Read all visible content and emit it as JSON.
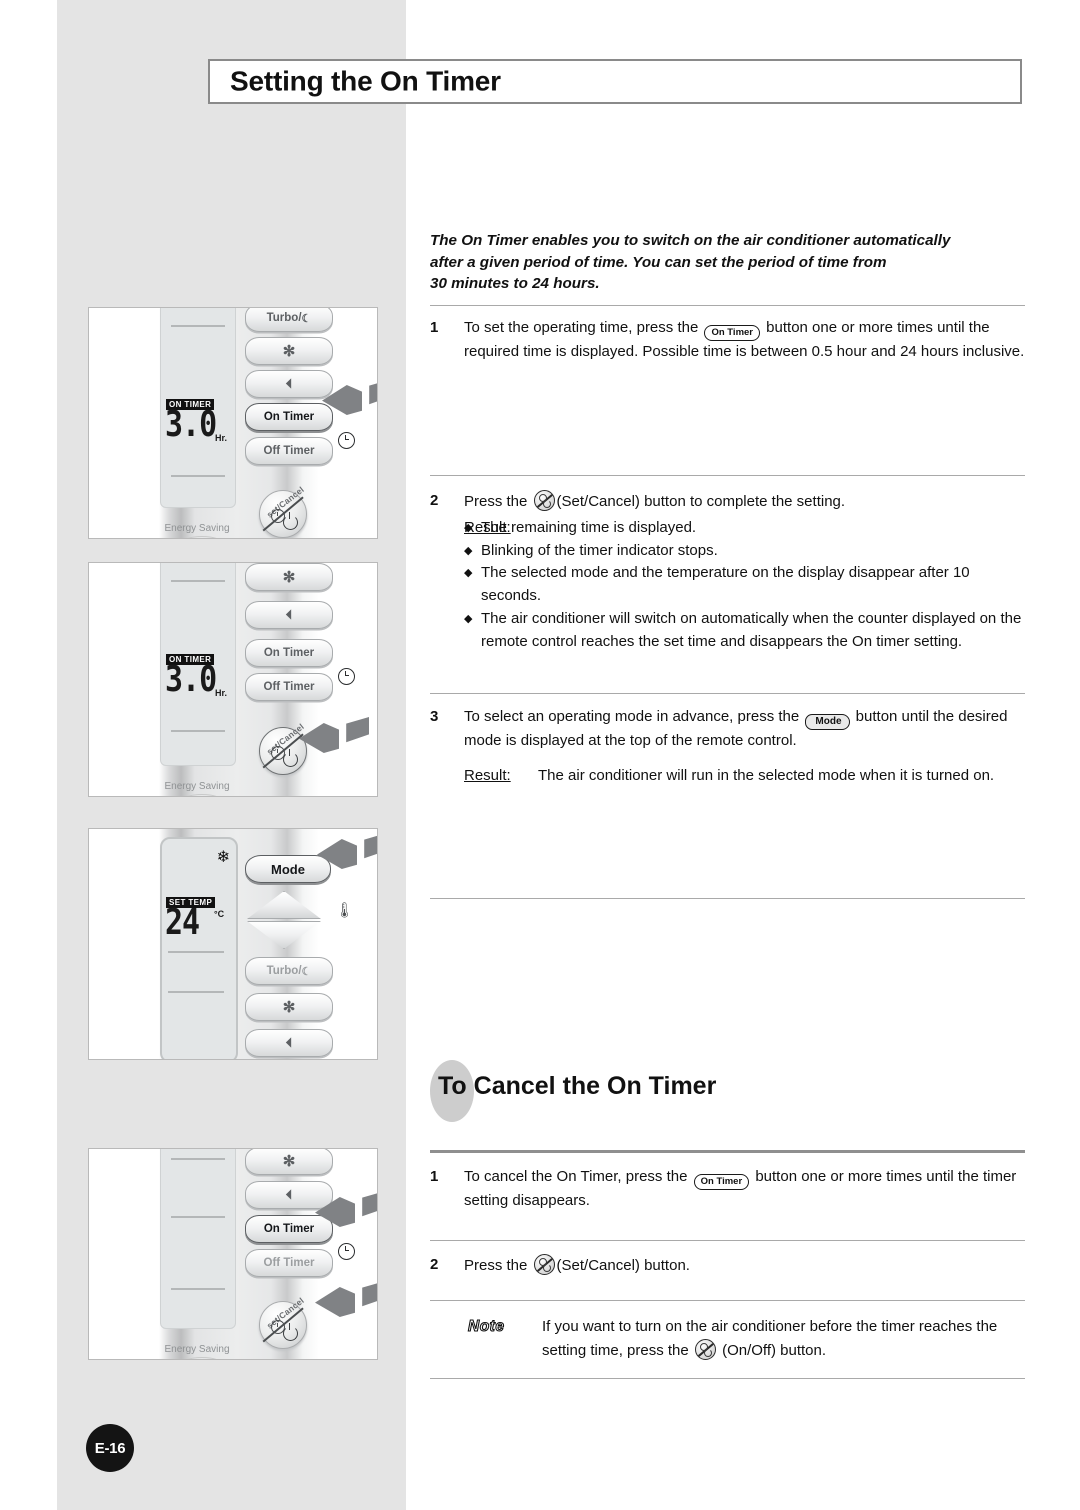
{
  "page": {
    "title": "Setting the On Timer",
    "page_number": "E-16",
    "background_color": "#e4e4e4"
  },
  "intro": {
    "line1": "The On Timer enables you to switch on the air conditioner automatically",
    "line2": "after a given period of time. You can set the period of time from",
    "line3": "30 minutes to 24 hours."
  },
  "steps": [
    {
      "number": "1",
      "text_before": "To set the operating time, press the",
      "inline_icon": "On Timer",
      "text_after": "button one or more times until the required time is displayed. Possible time is between 0.5 hour and 24 hours inclusive."
    },
    {
      "number": "2",
      "text_before": "Press the",
      "inline_icon": "set-cancel-icon",
      "text_after": "(Set/Cancel) button to complete the setting.",
      "result_label": "Result:",
      "result_bullets": [
        "The remaining time is displayed.",
        "Blinking of the timer indicator stops.",
        "The selected mode and the temperature on the display disappear after 10 seconds.",
        "The air conditioner will switch on automatically when the counter displayed on the remote control reaches the set time and disappears the On timer setting."
      ]
    },
    {
      "number": "3",
      "text_before": "To select an operating mode in advance, press the",
      "inline_icon": "Mode",
      "text_after": "button until the desired mode is displayed at the top of the remote control.",
      "result_label": "Result:",
      "result_text": "The air conditioner will run in the selected mode when it is turned on."
    }
  ],
  "section2": {
    "heading_prefix": "To",
    "heading_rest": "Cancel the On Timer",
    "steps": [
      {
        "number": "1",
        "text_before": "To cancel the On Timer, press the",
        "inline_icon": "On Timer",
        "text_after": "button one or more times until the timer setting disappears."
      },
      {
        "number": "2",
        "text_before": "Press the",
        "inline_icon": "set-cancel-icon",
        "text_after": "(Set/Cancel) button."
      }
    ],
    "note": {
      "label": "Note",
      "text_before": "If you want to turn on the air conditioner before the timer reaches the setting time, press the",
      "inline_icon": "on-off-icon",
      "text_after": "(On/Off) button."
    }
  },
  "illustrations": [
    {
      "id": "panel-1",
      "lcd": {
        "indicator": "ON TIMER",
        "value": "3.0",
        "unit": "Hr."
      },
      "buttons": [
        "Turbo/",
        "fan-speed-icon",
        "air-swing-icon",
        "On Timer",
        "Off Timer",
        "Set/Cancel"
      ],
      "highlighted_button": "On Timer",
      "label": "Energy Saving"
    },
    {
      "id": "panel-2",
      "lcd": {
        "indicator": "ON TIMER",
        "value": "3.0",
        "unit": "Hr."
      },
      "buttons": [
        "fan-speed-icon",
        "air-swing-icon",
        "On Timer",
        "Off Timer",
        "Set/Cancel"
      ],
      "highlighted_button": "Set/Cancel",
      "label": "Energy Saving"
    },
    {
      "id": "panel-3",
      "lcd": {
        "indicator": "SET TEMP",
        "value": "24",
        "unit": "°C",
        "mode_icon": "snowflake-icon"
      },
      "buttons": [
        "Mode",
        "temp-up-icon",
        "temp-down-icon",
        "Turbo/",
        "fan-speed-icon"
      ],
      "highlighted_button": "Mode"
    },
    {
      "id": "panel-4",
      "lcd": {
        "indicator": "",
        "value": "",
        "unit": ""
      },
      "buttons": [
        "fan-speed-icon",
        "air-swing-icon",
        "On Timer",
        "Off Timer",
        "Set/Cancel"
      ],
      "highlighted_button": "On Timer",
      "label": "Energy Saving"
    }
  ],
  "button_labels": {
    "turbo": "Turbo/",
    "on_timer": "On Timer",
    "off_timer": "Off Timer",
    "mode": "Mode",
    "energy_saving": "Energy Saving"
  }
}
